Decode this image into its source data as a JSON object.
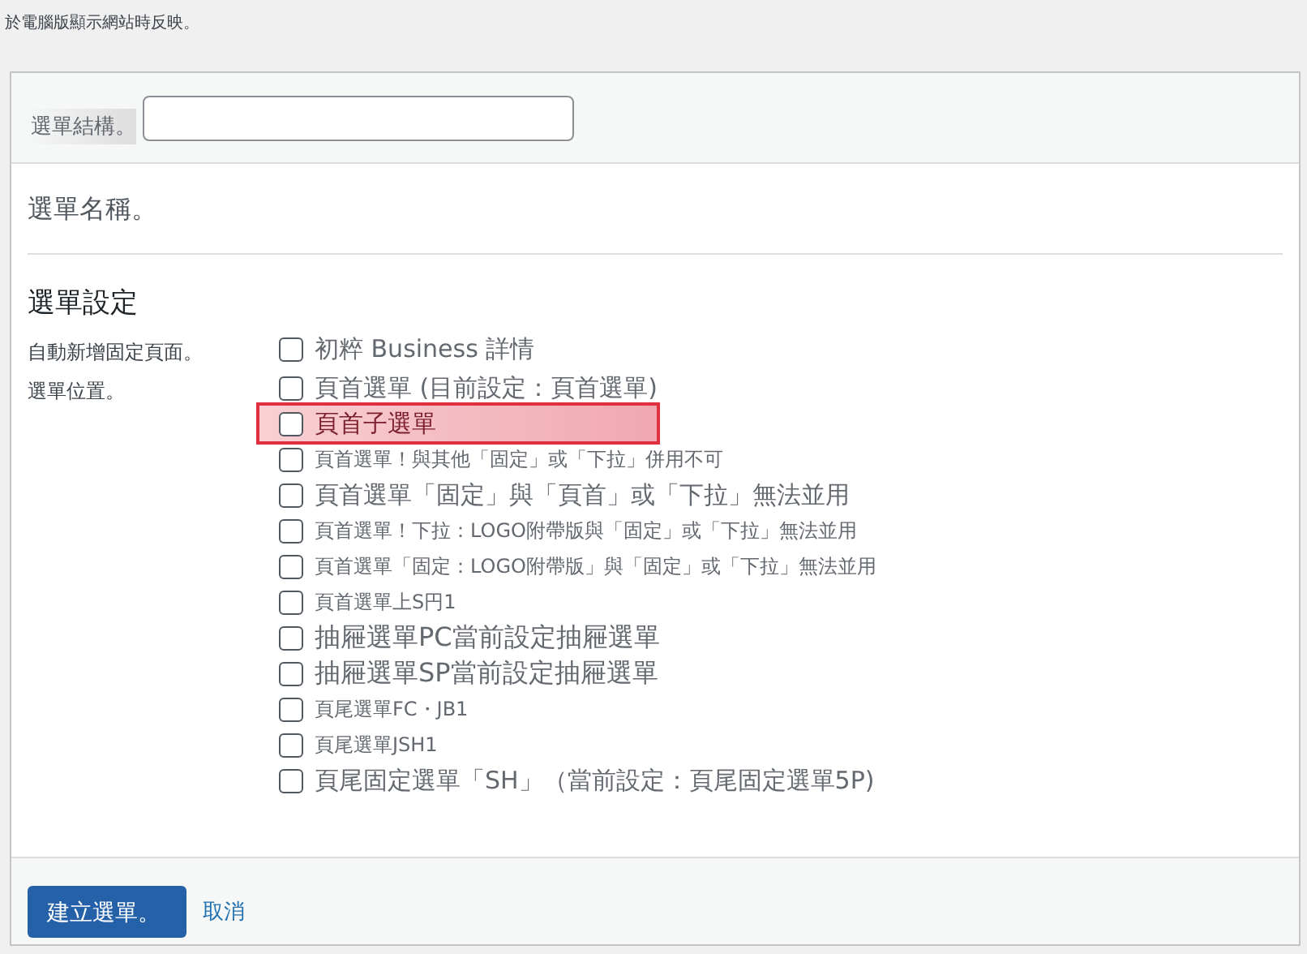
{
  "note": "於電腦版顯示網站時反映。",
  "structure": {
    "label": "選單結構。"
  },
  "menu_name": {
    "label": "選單名稱。"
  },
  "settings": {
    "heading": "選單設定",
    "auto_add": {
      "label": "自動新增固定頁面。",
      "options": [
        {
          "label": "初粹 Business 詳情",
          "checked": false,
          "kind": "medium",
          "highlighted": false
        }
      ]
    },
    "position": {
      "label": "選單位置。",
      "options": [
        {
          "label": "頁首選單 (目前設定：頁首選單)",
          "checked": false,
          "kind": "medium",
          "highlighted": false
        },
        {
          "label": "頁首子選單",
          "checked": false,
          "kind": "medium",
          "highlighted": true
        },
        {
          "label": "頁首選單！與其他「固定」或「下拉」併用不可",
          "checked": false,
          "kind": "small",
          "highlighted": false
        },
        {
          "label": "頁首選單「固定」與「頁首」或「下拉」無法並用",
          "checked": false,
          "kind": "medium",
          "highlighted": false
        },
        {
          "label": "頁首選單！下拉：LOGO附帶版與「固定」或「下拉」無法並用",
          "checked": false,
          "kind": "small",
          "highlighted": false
        },
        {
          "label": "頁首選單「固定：LOGO附帶版」與「固定」或「下拉」無法並用",
          "checked": false,
          "kind": "small",
          "highlighted": false
        },
        {
          "label": "頁首選單上S円1",
          "checked": false,
          "kind": "small",
          "highlighted": false
        },
        {
          "label": "抽屜選單PC當前設定抽屜選單",
          "checked": false,
          "kind": "large",
          "highlighted": false
        },
        {
          "label": "抽屜選單SP當前設定抽屜選單",
          "checked": false,
          "kind": "large",
          "highlighted": false
        },
        {
          "label": "頁尾選單FC・JB1",
          "checked": false,
          "kind": "small",
          "highlighted": false
        },
        {
          "label": "頁尾選單JSH1",
          "checked": false,
          "kind": "small",
          "highlighted": false
        },
        {
          "label": "頁尾固定選單「SH」（當前設定：頁尾固定選單5P)",
          "checked": false,
          "kind": "medium",
          "highlighted": false
        }
      ]
    }
  },
  "buttons": {
    "create": "建立選單。",
    "cancel": "取消"
  }
}
